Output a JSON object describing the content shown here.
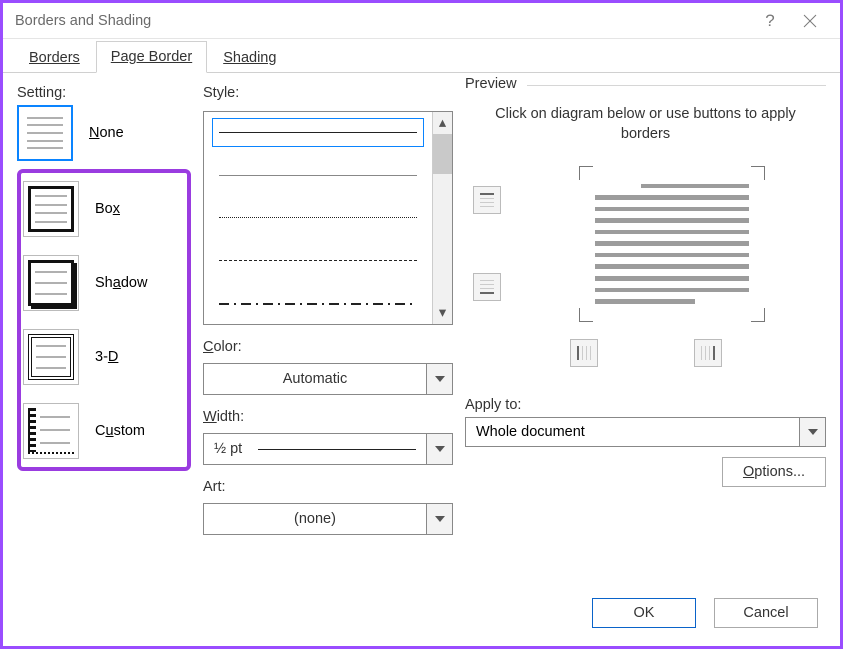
{
  "title": "Borders and Shading",
  "tabs": {
    "borders": "Borders",
    "page_border": "Page Border",
    "shading": "Shading"
  },
  "setting": {
    "label": "Setting:",
    "items": [
      {
        "label": "None"
      },
      {
        "label": "Box"
      },
      {
        "label": "Shadow"
      },
      {
        "label": "3-D"
      },
      {
        "label": "Custom"
      }
    ]
  },
  "style": {
    "label": "Style:"
  },
  "color": {
    "label": "Color:",
    "value": "Automatic"
  },
  "width": {
    "label": "Width:",
    "value": "½ pt"
  },
  "art": {
    "label": "Art:",
    "value": "(none)"
  },
  "preview": {
    "label": "Preview",
    "hint": "Click on diagram below or use buttons to apply borders"
  },
  "apply_to": {
    "label": "Apply to:",
    "value": "Whole document"
  },
  "buttons": {
    "options": "Options...",
    "ok": "OK",
    "cancel": "Cancel"
  }
}
